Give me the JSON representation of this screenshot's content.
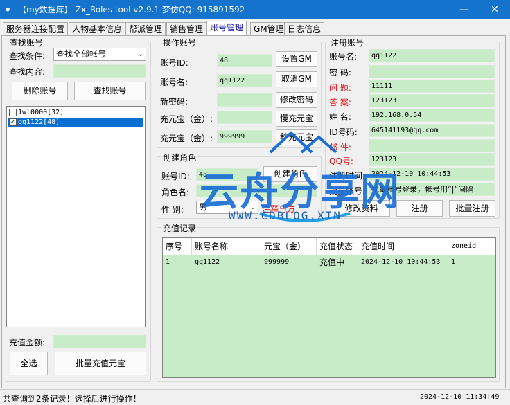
{
  "window": {
    "title": "【my数据库】 Zx_Roles tool v2.9.1 梦仿QQ:  915891592",
    "minimize": "—",
    "close": "✕"
  },
  "tabs": [
    "服务器连接配置",
    "人物基本信息",
    "帮派管理",
    "销售管理",
    "账号管理",
    "GM管理",
    "日志信息"
  ],
  "active_tab": "账号管理",
  "search": {
    "group": "查找账号",
    "condition_label": "查找条件:",
    "condition_value": "查找全部帐号",
    "content_label": "查找内容:",
    "content_value": "",
    "delete_btn": "删除账号",
    "search_btn": "查找账号"
  },
  "accounts": [
    {
      "label": "1wl0000[32]",
      "checked": false
    },
    {
      "label": "qq1122[48]",
      "checked": true
    }
  ],
  "recharge": {
    "label": "充值金额:",
    "value": "",
    "select_all": "全选",
    "batch_btn": "批量充值元宝"
  },
  "operate": {
    "group": "操作账号",
    "id_label": "账号ID:",
    "id_value": "48",
    "name_label": "账号名:",
    "name_value": "qq1122",
    "pwd_label": "新密码:",
    "pwd_value": "",
    "yb1_label": "充元宝（金）:",
    "yb1_value": "",
    "yb2_label": "充元宝（金）:",
    "yb2_value": "999999",
    "set_gm": "设置GM",
    "cancel_gm": "取消GM",
    "change_pwd": "修改密码",
    "slow_yb": "慢充元宝",
    "fast_yb": "秒充元宝"
  },
  "create_role": {
    "group": "创建角色",
    "id_label": "账号ID:",
    "id_value": "48",
    "create_btn": "创建角色",
    "name_label": "角色名:",
    "sex_label": "性  别:",
    "sex_value": "男",
    "note": "注释与方"
  },
  "register": {
    "group": "注册账号",
    "name_label": "账号名:",
    "name_value": "qq1122",
    "pwd_label": "密  码:",
    "pwd_value": "",
    "q_label": "问  题:",
    "q_value": "11111",
    "a_label": "答  案:",
    "a_value": "123123",
    "n_label": "姓  名:",
    "n_value": "192.168.0.54",
    "id_label": "ID号码:",
    "id_value": "645141193@qq.com",
    "mail_label": "邮  件:",
    "mail_value": "",
    "qq_label": "QQ号:",
    "qq_value": "123123",
    "time_label": "注册时间:",
    "time_value": "2024-12-10 10:44:53",
    "batch_label": "批量账号:",
    "batch_value": "批量账号登录，帐号用“|”间隔",
    "edit_btn": "修改资料",
    "register_btn": "注册",
    "batch_register_btn": "批量注册"
  },
  "records": {
    "group": "充值记录",
    "headers": [
      "序号",
      "账号名称",
      "元宝（金）",
      "充值状态",
      "充值时间",
      "zoneid"
    ],
    "row": [
      "1",
      "qq1122",
      "999999",
      "充值中",
      "2024-12-10 10:44:53",
      "1"
    ]
  },
  "status_bar": {
    "message": "共查询到2条记录！选择后进行操作！",
    "time": "2024-12-10  11:34:49"
  },
  "watermark": {
    "main": "云舟分享网",
    "url": "WWW.CDBLOG.XIN"
  }
}
